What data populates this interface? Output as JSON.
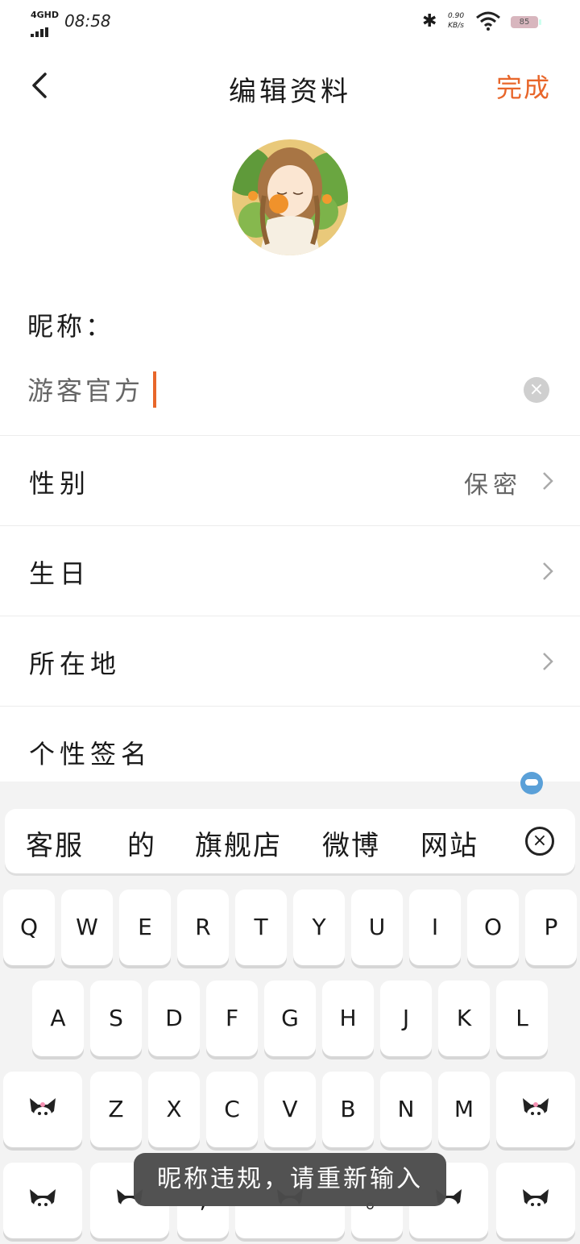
{
  "status": {
    "network": "4GHD",
    "time": "08:58",
    "speed_value": "0.90",
    "speed_unit": "KB/s",
    "battery": "85"
  },
  "header": {
    "title": "编辑资料",
    "done_label": "完成"
  },
  "nickname": {
    "label": "昵称：",
    "value": "游客官方"
  },
  "rows": [
    {
      "label": "性别",
      "value": "保密"
    },
    {
      "label": "生日",
      "value": ""
    },
    {
      "label": "所在地",
      "value": ""
    },
    {
      "label": "个性签名",
      "value": ""
    }
  ],
  "keyboard": {
    "candidates": [
      "客服",
      "的",
      "旗舰店",
      "微博",
      "网站"
    ],
    "row1": [
      "Q",
      "W",
      "E",
      "R",
      "T",
      "Y",
      "U",
      "I",
      "O",
      "P"
    ],
    "row2": [
      "A",
      "S",
      "D",
      "F",
      "G",
      "H",
      "J",
      "K",
      "L"
    ],
    "row3": [
      "Z",
      "X",
      "C",
      "V",
      "B",
      "N",
      "M"
    ],
    "row4": [
      ",",
      "。"
    ]
  },
  "toast": "昵称违规，请重新输入",
  "colors": {
    "accent": "#e8662a",
    "toast_bg": "#4c4c4c",
    "keyboard_bg": "#f3f3f3"
  }
}
